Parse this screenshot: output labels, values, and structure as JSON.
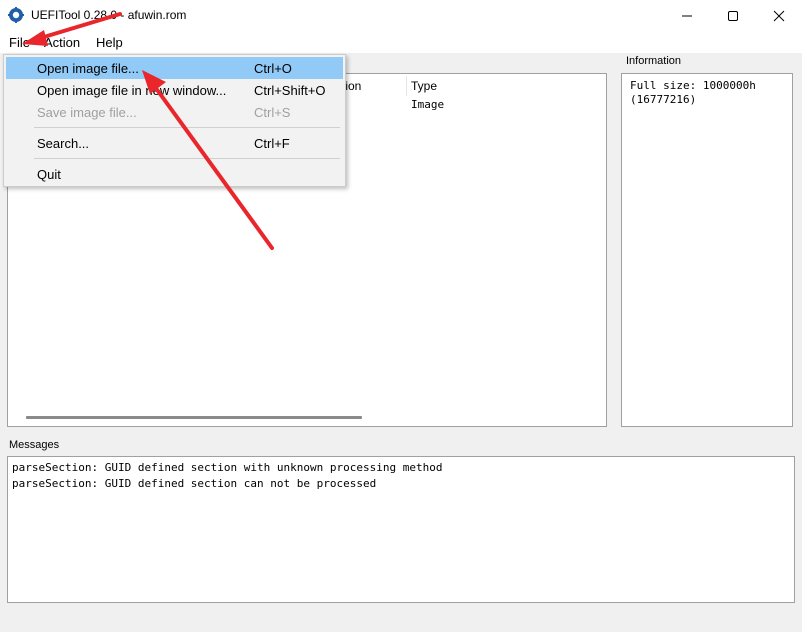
{
  "window": {
    "app_name": "UEFITool 0.28.0",
    "file_name": "afuwin.rom",
    "title": "UEFITool 0.28.0 - afuwin.rom",
    "controls": {
      "minimize": "minimize-icon",
      "maximize": "maximize-icon",
      "close": "close-icon"
    }
  },
  "menubar": {
    "file": "File",
    "action": "Action",
    "help": "Help"
  },
  "file_menu": {
    "items": [
      {
        "label": "Open image file...",
        "shortcut": "Ctrl+O",
        "highlighted": true,
        "enabled": true
      },
      {
        "label": "Open image file in new window...",
        "shortcut": "Ctrl+Shift+O",
        "highlighted": false,
        "enabled": true
      },
      {
        "label": "Save image file...",
        "shortcut": "Ctrl+S",
        "highlighted": false,
        "enabled": false
      },
      {
        "label": "Search...",
        "shortcut": "Ctrl+F",
        "highlighted": false,
        "enabled": true
      },
      {
        "label": "Quit",
        "shortcut": "",
        "highlighted": false,
        "enabled": true
      }
    ]
  },
  "tree": {
    "columns": {
      "action_partial": "tion",
      "type": "Type"
    },
    "rows": [
      {
        "type": "Image"
      }
    ]
  },
  "information": {
    "label": "Information",
    "text": "Full size: 1000000h\n(16777216)"
  },
  "messages": {
    "label": "Messages",
    "lines": [
      "parseSection: GUID defined section with unknown processing method",
      "parseSection: GUID defined section can not be processed"
    ]
  },
  "colors": {
    "menu_highlight": "#91c9f7",
    "annotation_arrow": "#e8262b",
    "app_icon": "#1f5fa8"
  }
}
